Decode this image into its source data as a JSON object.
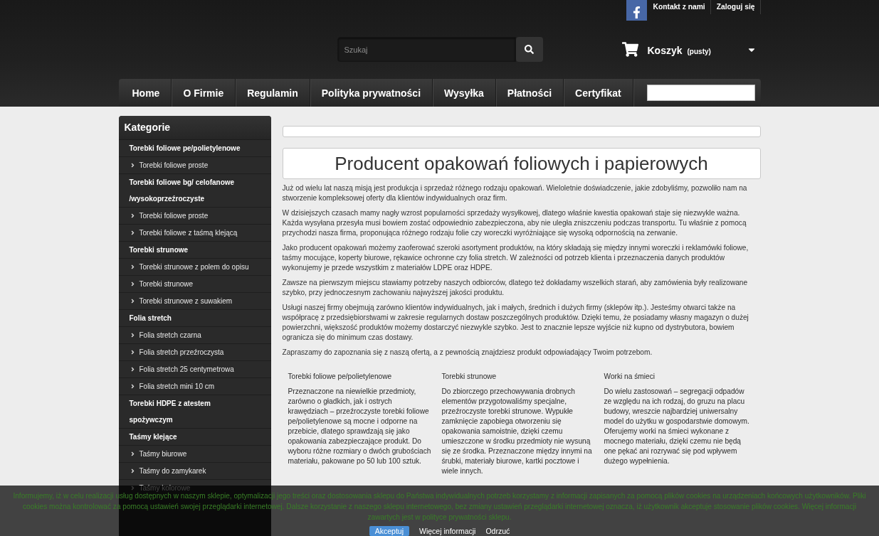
{
  "header": {
    "top_links": [
      "Kontakt z nami",
      "Zaloguj się"
    ],
    "search": {
      "placeholder": "Szukaj"
    },
    "cart": {
      "label": "Koszyk",
      "status": "(pusty)"
    }
  },
  "nav": {
    "items": [
      "Home",
      "O Firmie",
      "Regulamin",
      "Polityka prywatności",
      "Wysyłka",
      "Płatności",
      "Certyfikat"
    ]
  },
  "sidebar": {
    "title": "Kategorie",
    "categories": [
      {
        "label": "Torebki foliowe pe/polietylenowe",
        "children": [
          {
            "label": "Torebki foliowe proste"
          }
        ]
      },
      {
        "label": "Torebki foliowe bg/ celofanowe /wysokoprzeźroczyste",
        "children": [
          {
            "label": "Torebki foliowe proste"
          },
          {
            "label": "Torebki foliowe z taśmą klejącą"
          }
        ]
      },
      {
        "label": "Torebki strunowe",
        "children": [
          {
            "label": "Torebki strunowe z polem do opisu"
          },
          {
            "label": "Torebki strunowe"
          },
          {
            "label": "Torebki strunowe z suwakiem"
          }
        ]
      },
      {
        "label": "Folia stretch",
        "children": [
          {
            "label": "Folia stretch czarna"
          },
          {
            "label": "Folia stretch przeźroczysta"
          },
          {
            "label": "Folia stretch 25 centymetrowa"
          },
          {
            "label": "Folia stretch mini 10 cm"
          }
        ]
      },
      {
        "label": "Torebki HDPE z atestem spożywczym"
      },
      {
        "label": "Taśmy klejące",
        "children": [
          {
            "label": "Taśmy biurowe"
          },
          {
            "label": "Taśmy do zamykarek"
          },
          {
            "label": "Taśmy kolorowe"
          }
        ]
      }
    ]
  },
  "content": {
    "title": "Producent opakowań foliowych i papierowych",
    "paragraphs": [
      "Już od wielu lat naszą misją jest produkcja i sprzedaż różnego rodzaju opakowań. Wieloletnie doświadczenie, jakie zdobyliśmy, pozwoliło nam na stworzenie kompleksowej oferty dla klientów indywidualnych oraz firm.",
      "W dzisiejszych czasach mamy nagły wzrost popularności sprzedaży wysyłkowej, dlatego właśnie kwestia opakowań staje się niezwykle ważna. Każda wysyłana przesyła musi bowiem zostać odpowiednio zabezpieczona, aby nie uległa zniszczeniu podczas transportu. Tu właśnie z pomocą przychodzi nasza firma, proponująca różnego rodzaju folie czy woreczki wyróżniające się wysoką odpornością na zerwanie.",
      "Jako producent opakowań możemy zaoferować szeroki asortyment produktów, na który składają się między innymi woreczki i reklamówki foliowe, taśmy mocujące, koperty biurowe, rękawice ochronne czy folia stretch. W zależności od potrzeb klienta i przeznaczenia danych produktów wykonujemy je przede wszystkim z materiałów LDPE oraz HDPE.",
      "Zawsze na pierwszym miejscu stawiamy potrzeby naszych odbiorców, dlatego też dokładamy wszelkich starań, aby zamówienia były realizowane szybko, przy jednoczesnym zachowaniu najwyższej jakości produktu.",
      "Usługi naszej firmy obejmują zarówno klientów indywidualnych, jak i małych, średnich i dużych firmy (sklepów itp.). Jesteśmy otwarci także na współpracę z przedsiębiorstwami w zakresie regularnych dostaw poszczególnych produktów. Dzięki temu, że posiadamy własny magazyn o dużej powierzchni, większość produktów możemy dostarczyć niezwykle szybko. Jest to znacznie lepsze wyjście niż kupno od dystrybutora, bowiem ogranicza się do minimum czas dostawy.",
      "Zapraszamy do zapoznania się z naszą ofertą, a z pewnością znajdziesz produkt odpowiadający Twoim potrzebom."
    ],
    "features": [
      {
        "heading": "Torebki foliowe pe/polietylenowe",
        "text": "Przeznaczone na niewielkie przedmioty, zarówno o gładkich, jak i ostrych krawędziach – przeźroczyste torebki foliowe pe/polietylenowe są mocne i odporne na przebicie, dlatego sprawdzają się jako opakowania zabezpieczające produkt. Do wyboru różne rozmiary o dwóch grubościach materiału, pakowane po 50 lub 100 sztuk."
      },
      {
        "heading": "Torebki strunowe",
        "text": "Do zbiorczego przechowywania drobnych elementów przygotowaliśmy specjalne, przeźroczyste torebki strunowe. Wypukłe zamknięcie zapobiega otworzeniu się opakowania samoistnie, dzięki czemu umieszczone w środku przedmioty nie wysuną się ze środka. Przeznaczone między innymi na śrubki, materiały biurowe, kartki pocztowe i wiele innych."
      },
      {
        "heading": "Worki na śmieci",
        "text": "Do wielu zastosowań – segregacji odpadów ze względu na ich rodzaj, do gruzu na placu budowy, wreszcie najbardziej uniwersalny model do użytku w gospodarstwie domowym. Oferujemy worki na śmieci wykonane z mocnego materiału, dzięki czemu nie będą one pękać ani rozrywać się pod wpływem dużego wypełnienia."
      }
    ]
  },
  "cookie_bar": {
    "text": "Informujemy, iż w celu realizacji usług dostępnych w naszym sklepie, optymalizacji jego treści oraz dostosowania sklepu do Państwa indywidualnych potrzeb korzystamy z informacji zapisanych za pomocą plików cookies na urządzeniach końcowych użytkowników. Pliki cookies można kontrolować za pomocą ustawień swojej przeglądarki internetowej. Dalsze korzystanie z naszego sklepu internetowego, bez zmiany ustawień przeglądarki internetowej oznacza, iż użytkownik akceptuje stosowanie plików cookies. Więcej informacji zawartych jest w polityce prywatności sklepu.",
    "buttons": [
      {
        "label": "Akceptuj",
        "kind": "primary"
      },
      {
        "label": "Więcej informacji",
        "kind": "link"
      },
      {
        "label": "Odrzuć",
        "kind": "link"
      }
    ]
  }
}
